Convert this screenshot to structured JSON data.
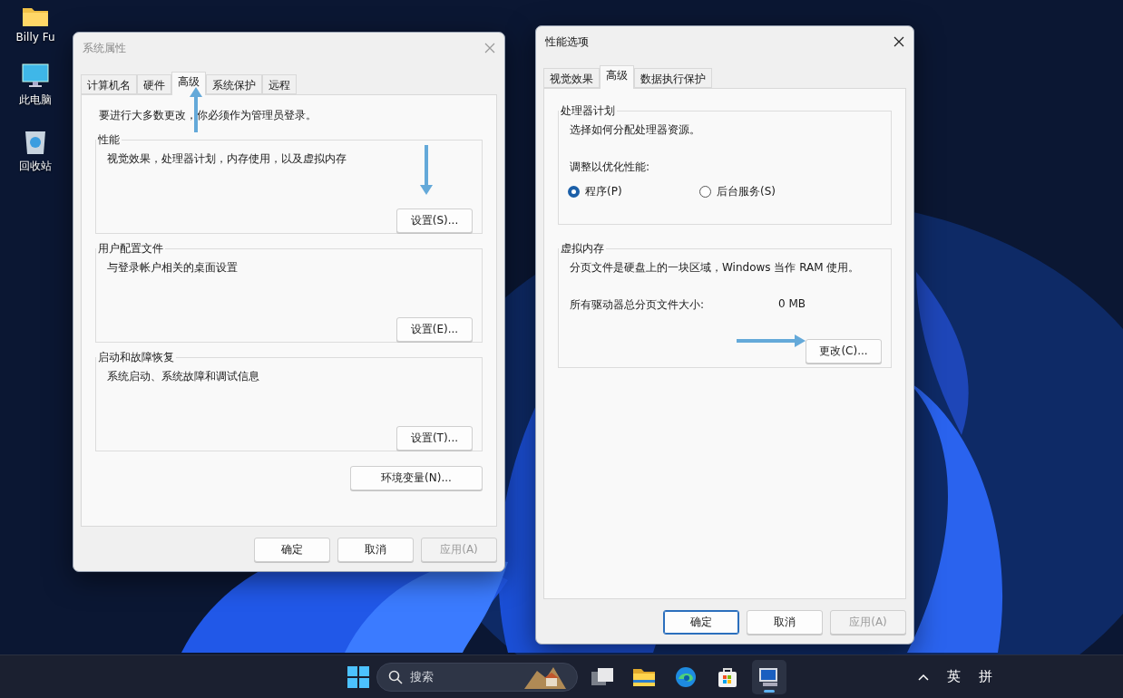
{
  "desktop_icons": [
    {
      "kind": "folder",
      "label": "Billy Fu"
    },
    {
      "kind": "computer",
      "label": "此电脑"
    },
    {
      "kind": "recycle",
      "label": "回收站"
    }
  ],
  "system_properties": {
    "title": "系统属性",
    "active": false,
    "tabs": [
      {
        "label": "计算机名",
        "selected": false
      },
      {
        "label": "硬件",
        "selected": false
      },
      {
        "label": "高级",
        "selected": true
      },
      {
        "label": "系统保护",
        "selected": false
      },
      {
        "label": "远程",
        "selected": false
      }
    ],
    "notice": "要进行大多数更改，你必须作为管理员登录。",
    "groups": [
      {
        "title": "性能",
        "description": "视觉效果，处理器计划，内存使用，以及虚拟内存",
        "button": "设置(S)..."
      },
      {
        "title": "用户配置文件",
        "description": "与登录帐户相关的桌面设置",
        "button": "设置(E)..."
      },
      {
        "title": "启动和故障恢复",
        "description": "系统启动、系统故障和调试信息",
        "button": "设置(T)..."
      }
    ],
    "env_button": "环境变量(N)...",
    "buttons": [
      {
        "label": "确定",
        "default": false,
        "disabled": false
      },
      {
        "label": "取消",
        "default": false,
        "disabled": false
      },
      {
        "label": "应用(A)",
        "default": false,
        "disabled": true
      }
    ]
  },
  "performance_options": {
    "title": "性能选项",
    "active": true,
    "tabs": [
      {
        "label": "视觉效果",
        "selected": false
      },
      {
        "label": "高级",
        "selected": true
      },
      {
        "label": "数据执行保护",
        "selected": false
      }
    ],
    "processor": {
      "title": "处理器计划",
      "description": "选择如何分配处理器资源。",
      "prompt": "调整以优化性能:",
      "options": [
        {
          "label": "程序(P)",
          "selected": true
        },
        {
          "label": "后台服务(S)",
          "selected": false
        }
      ]
    },
    "virtual_memory": {
      "title": "虚拟内存",
      "description": "分页文件是硬盘上的一块区域，Windows 当作 RAM 使用。",
      "total_label": "所有驱动器总分页文件大小:",
      "total_value": "0 MB",
      "button": "更改(C)..."
    },
    "buttons": [
      {
        "label": "确定",
        "default": true,
        "disabled": false
      },
      {
        "label": "取消",
        "default": false,
        "disabled": false
      },
      {
        "label": "应用(A)",
        "default": false,
        "disabled": true
      }
    ]
  },
  "taskbar": {
    "search_placeholder": "搜索",
    "apps": [
      {
        "kind": "taskview",
        "active": false
      },
      {
        "kind": "explorer",
        "active": false
      },
      {
        "kind": "edge",
        "active": false
      },
      {
        "kind": "store",
        "active": false
      },
      {
        "kind": "sysprops",
        "active": true
      }
    ],
    "languages": [
      "英",
      "拼"
    ]
  }
}
